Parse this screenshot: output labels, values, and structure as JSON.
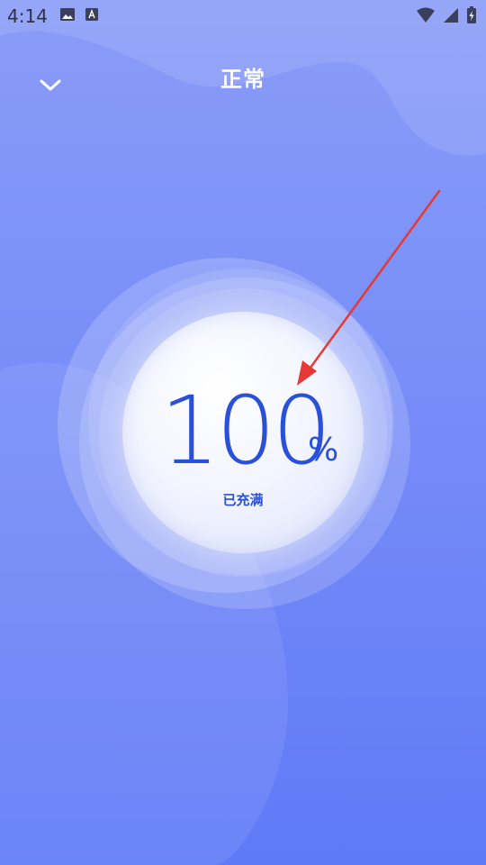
{
  "status_bar": {
    "time": "4:14",
    "left_icons": [
      "image-icon",
      "a-text-icon"
    ],
    "right_icons": [
      "wifi-icon",
      "signal-icon",
      "battery-charging-icon"
    ]
  },
  "header": {
    "title": "正常",
    "back_icon": "chevron-down-icon"
  },
  "battery": {
    "level_value": "100",
    "unit": "%",
    "status": "已充满",
    "level_fraction": 1.0
  },
  "colors": {
    "bg_top": "#8a9cf8",
    "bg_bottom": "#5f7af7",
    "accent": "#2a4fd9",
    "arrow": "#e53935",
    "title": "#ffffff"
  }
}
